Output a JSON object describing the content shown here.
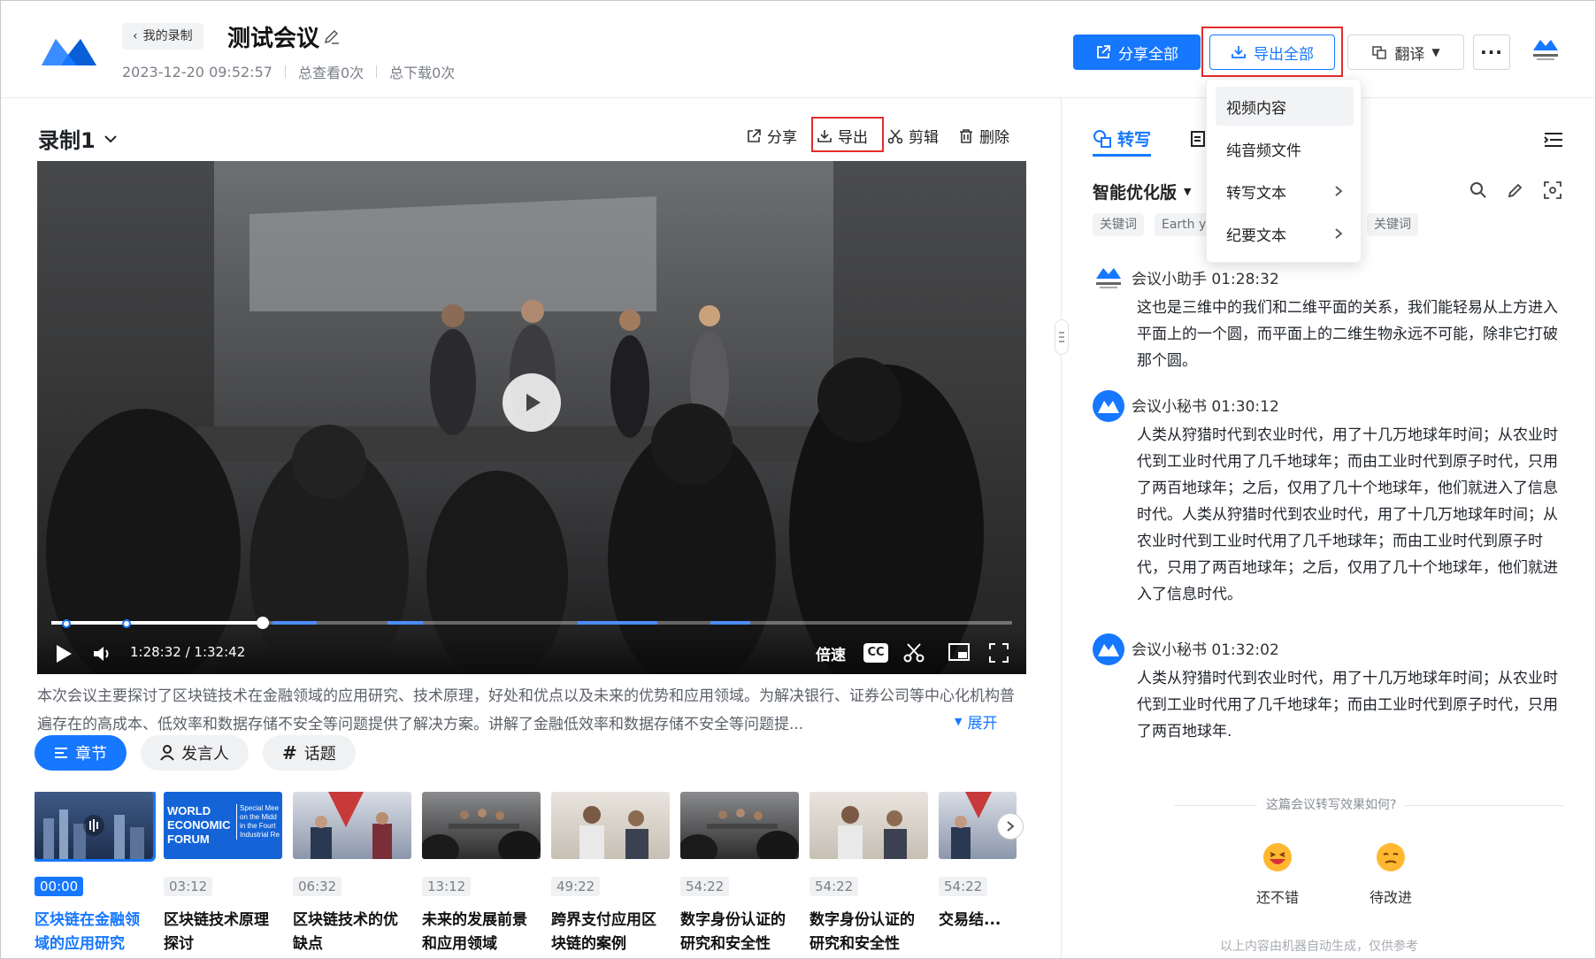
{
  "header": {
    "back_label": "我的录制",
    "title": "测试会议",
    "date": "2023-12-20 09:52:57",
    "views": "总查看0次",
    "downloads": "总下载0次",
    "share_all": "分享全部",
    "export_all": "导出全部",
    "translate": "翻译",
    "more": "···"
  },
  "export_menu": {
    "items": [
      "视频内容",
      "纯音频文件",
      "转写文本",
      "纪要文本"
    ]
  },
  "recording": {
    "title": "录制1",
    "actions": {
      "share": "分享",
      "export": "导出",
      "clip": "剪辑",
      "delete": "删除"
    }
  },
  "player": {
    "time": "1:28:32 / 1:32:42",
    "speed": "倍速",
    "cc": "CC",
    "progress": 0.22
  },
  "summary": {
    "text": "本次会议主要探讨了区块链技术在金融领域的应用研究、技术原理，好处和优点以及未来的优势和应用领域。为解决银行、证券公司等中心化机构普遍存在的高成本、低效率和数据存储不安全等问题提供了解决方案。讲解了金融低效率和数据存储不安全等问题提...",
    "expand": "展开"
  },
  "view_tabs": [
    "章节",
    "发言人",
    "话题"
  ],
  "chapters": [
    {
      "time": "00:00",
      "title": "区块链在金融领域的应用研究"
    },
    {
      "time": "03:12",
      "title": "区块链技术原理探讨"
    },
    {
      "time": "06:32",
      "title": "区块链技术的优缺点"
    },
    {
      "time": "13:12",
      "title": "未来的发展前景和应用领域"
    },
    {
      "time": "49:22",
      "title": "跨界支付应用区块链的案例"
    },
    {
      "time": "54:22",
      "title": "数字身份认证的研究和安全性"
    },
    {
      "time": "54:22",
      "title": "数字身份认证的研究和安全性"
    },
    {
      "time": "54:22",
      "title": "交易结..."
    }
  ],
  "forum_thumb": {
    "line1": "WORLD",
    "line2": "ECONOMIC",
    "line3": "FORUM",
    "side": "Special Mee on the Midd in the Fourt Industrial Re"
  },
  "right_panel": {
    "tab_transcript": "转写",
    "version": "智能优化版",
    "chips": [
      "关键词",
      "Earth y",
      "关键词"
    ],
    "messages": [
      {
        "speaker": "会议小助手  01:28:32",
        "text": "这也是三维中的我们和二维平面的关系，我们能轻易从上方进入平面上的一个圆，而平面上的二维生物永远不可能，除非它打破那个圆。"
      },
      {
        "speaker": "会议小秘书  01:30:12",
        "text": "人类从狩猎时代到农业时代，用了十几万地球年时间；从农业时代到工业时代用了几千地球年；而由工业时代到原子时代，只用了两百地球年；之后，仅用了几十个地球年，他们就进入了信息时代。人类从狩猎时代到农业时代，用了十几万地球年时间；从农业时代到工业时代用了几千地球年；而由工业时代到原子时代，只用了两百地球年；之后，仅用了几十个地球年，他们就进入了信息时代。"
      },
      {
        "speaker": "会议小秘书  01:32:02",
        "text": "人类从狩猎时代到农业时代，用了十几万地球年时间；从农业时代到工业时代用了几千地球年；而由工业时代到原子时代，只用了两百地球年."
      }
    ],
    "feedback_question": "这篇会议转写效果如何?",
    "feedback_good": "还不错",
    "feedback_bad": "待改进",
    "footnote": "以上内容由机器自动生成，仅供参考"
  },
  "colors": {
    "accent": "#1677ff",
    "highlight": "#e52b2b"
  }
}
